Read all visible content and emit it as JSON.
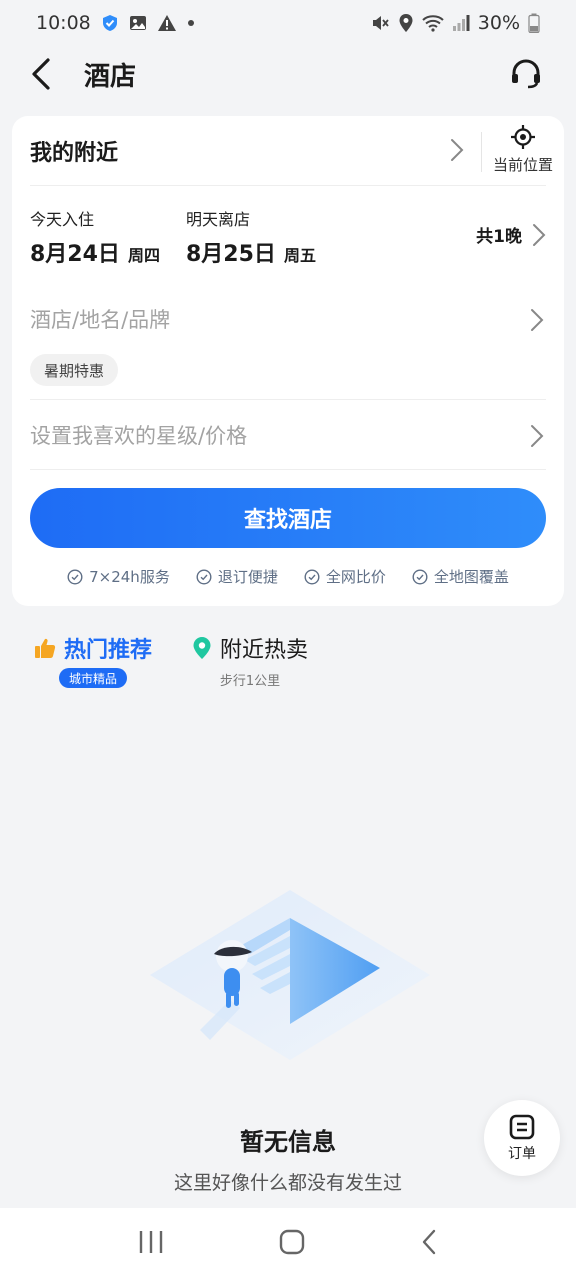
{
  "status_bar": {
    "time": "10:08",
    "battery": "30%"
  },
  "header": {
    "title": "酒店"
  },
  "card": {
    "location": "我的附近",
    "current_location_label": "当前位置",
    "checkin_caption": "今天入住",
    "checkin_date": "8月24日",
    "checkin_weekday": "周四",
    "checkout_caption": "明天离店",
    "checkout_date": "8月25日",
    "checkout_weekday": "周五",
    "nights": "共1晚",
    "search_placeholder": "酒店/地名/品牌",
    "tag": "暑期特惠",
    "star_price_placeholder": "设置我喜欢的星级/价格",
    "search_button": "查找酒店",
    "features": [
      "7×24h服务",
      "退订便捷",
      "全网比价",
      "全地图覆盖"
    ]
  },
  "tabs": {
    "hot_label": "热门推荐",
    "hot_badge": "城市精品",
    "near_label": "附近热卖",
    "near_sub": "步行1公里"
  },
  "empty": {
    "title": "暂无信息",
    "subtitle": "这里好像什么都没有发生过"
  },
  "fab": {
    "label": "订单"
  },
  "colors": {
    "accent": "#1e6cf5",
    "location_pin": "#1fc7a0",
    "thumb": "#f5a623"
  }
}
